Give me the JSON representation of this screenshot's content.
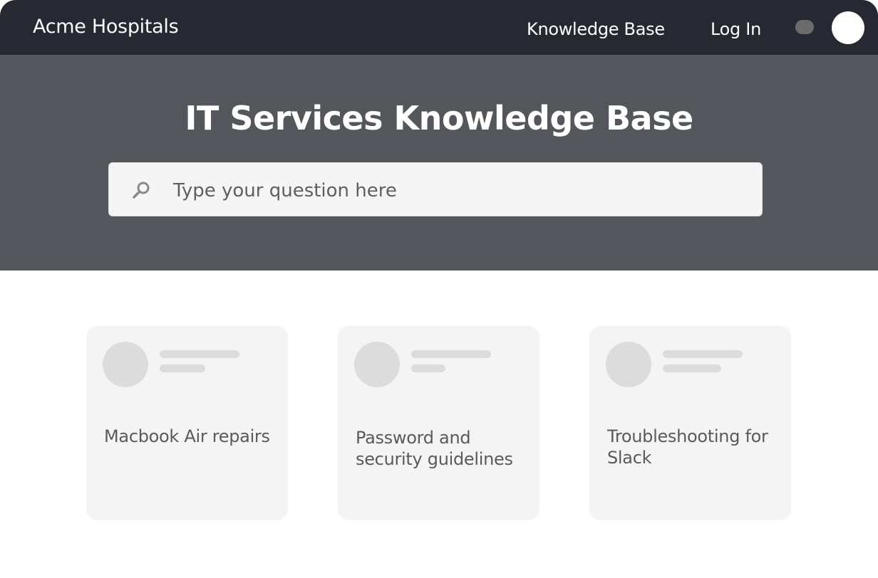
{
  "topbar": {
    "brand": "Acme Hospitals",
    "nav": [
      {
        "label": "Knowledge Base"
      },
      {
        "label": "Log In"
      }
    ],
    "icons": {
      "toggle": "status-dot-icon",
      "avatar": "user-avatar"
    }
  },
  "hero": {
    "title": "IT Services Knowledge Base",
    "search": {
      "value": "",
      "placeholder": "Type your question here",
      "icon": "search-icon"
    }
  },
  "cards": [
    {
      "title": "Macbook Air repairs"
    },
    {
      "title": "Password and security guidelines"
    },
    {
      "title": "Troubleshooting for Slack"
    }
  ],
  "colors": {
    "topbar": "#262932",
    "hero": "#53565b",
    "card": "#f4f4f4",
    "placeholder_shape": "#dcdcdc"
  }
}
